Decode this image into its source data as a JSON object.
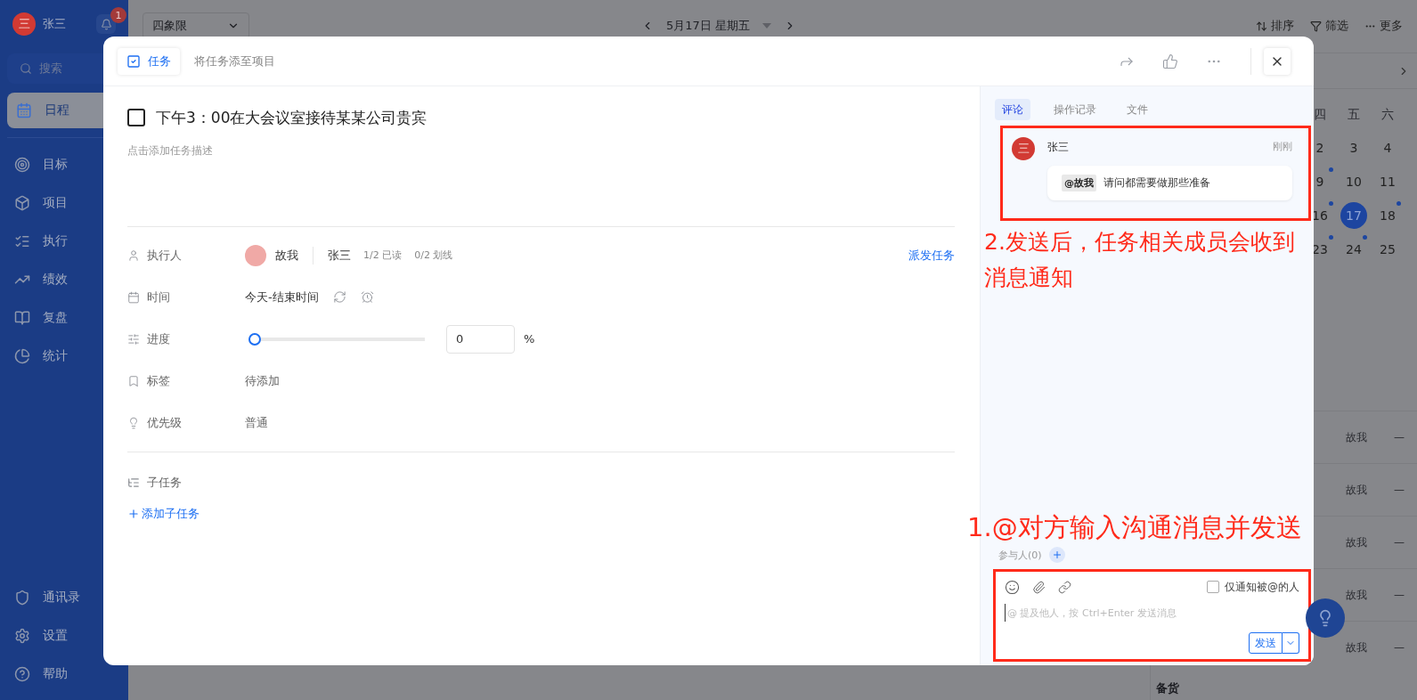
{
  "sidebar": {
    "user": {
      "avatar": "三",
      "name": "张三",
      "notifications": "1"
    },
    "search": {
      "placeholder": "搜索"
    },
    "items": [
      {
        "label": "日程",
        "selected": true
      },
      {
        "label": "目标",
        "selected": false
      },
      {
        "label": "项目",
        "selected": false
      },
      {
        "label": "执行",
        "selected": false
      },
      {
        "label": "绩效",
        "selected": false
      },
      {
        "label": "复盘",
        "selected": false
      },
      {
        "label": "统计",
        "selected": false
      }
    ],
    "bottom_items": [
      {
        "label": "通讯录"
      },
      {
        "label": "设置"
      },
      {
        "label": "帮助"
      }
    ]
  },
  "top_bar": {
    "view_select": "四象限",
    "date": "5月17日 星期五",
    "actions": [
      "排序",
      "筛选",
      "更多"
    ]
  },
  "calendar": {
    "weekdays": [
      "四",
      "五",
      "六"
    ],
    "weeks": [
      [
        {
          "day": "2",
          "has_events": false,
          "selected": false
        },
        {
          "day": "3",
          "has_events": false,
          "selected": false
        },
        {
          "day": "4",
          "has_events": false,
          "selected": false
        }
      ],
      [
        {
          "day": "9",
          "has_events": true,
          "selected": false
        },
        {
          "day": "10",
          "has_events": false,
          "selected": false
        },
        {
          "day": "11",
          "has_events": false,
          "selected": false
        }
      ],
      [
        {
          "day": "16",
          "has_events": true,
          "selected": false
        },
        {
          "day": "17",
          "has_events": false,
          "selected": true
        },
        {
          "day": "18",
          "has_events": true,
          "selected": false
        }
      ],
      [
        {
          "day": "23",
          "has_events": true,
          "selected": false
        },
        {
          "day": "24",
          "has_events": true,
          "selected": false
        },
        {
          "day": "25",
          "has_events": false,
          "selected": false
        }
      ]
    ]
  },
  "task_list": {
    "rows": [
      {
        "assignee": "故我",
        "status": "—"
      },
      {
        "assignee": "故我",
        "status": "—"
      },
      {
        "assignee": "故我",
        "status": "—"
      },
      {
        "assignee": "故我",
        "status": "—"
      },
      {
        "assignee": "故我",
        "status": "—"
      }
    ],
    "footer": "备货"
  },
  "modal": {
    "tabs": [
      {
        "label": "任务",
        "selected": true
      },
      {
        "label": "将任务添至项目",
        "selected": false
      }
    ],
    "task": {
      "title": "下午3：00在大会议室接待某某公司贵宾",
      "done": false,
      "description_placeholder": "点击添加任务描述"
    },
    "fields": [
      {
        "kind": "assignee",
        "label": "执行人",
        "assignee": "故我",
        "owner": "张三",
        "read": "1/2 已读",
        "underline": "0/2 划线",
        "action": "派发任务"
      },
      {
        "kind": "time",
        "label": "时间",
        "value": "今天-结束时间"
      },
      {
        "kind": "progress",
        "label": "进度",
        "level": 0,
        "value": "0",
        "unit": "%"
      },
      {
        "kind": "text",
        "label": "标签",
        "value": "待添加"
      },
      {
        "kind": "text",
        "label": "优先级",
        "value": "普通"
      }
    ],
    "subtasks": {
      "label": "子任务",
      "add": "添加子任务"
    },
    "panel": {
      "tabs": [
        {
          "label": "评论",
          "selected": true
        },
        {
          "label": "操作记录",
          "selected": false
        },
        {
          "label": "文件",
          "selected": false
        }
      ],
      "comments": [
        {
          "avatar": "三",
          "author": "张三",
          "time": "刚刚",
          "mention": "@故我",
          "text": "请问都需要做那些准备"
        }
      ],
      "participants": "参与人(0)",
      "composer": {
        "notify_only_mentioned": {
          "label": "仅通知被@的人",
          "checked": false
        },
        "placeholder": "@ 提及他人，按 Ctrl+Enter 发送消息",
        "send": "发送"
      }
    }
  },
  "annotations": [
    {
      "text": "2.发送后，任务相关成员会收到消息通知"
    },
    {
      "text": "1.@对方输入沟通消息并发送"
    }
  ]
}
